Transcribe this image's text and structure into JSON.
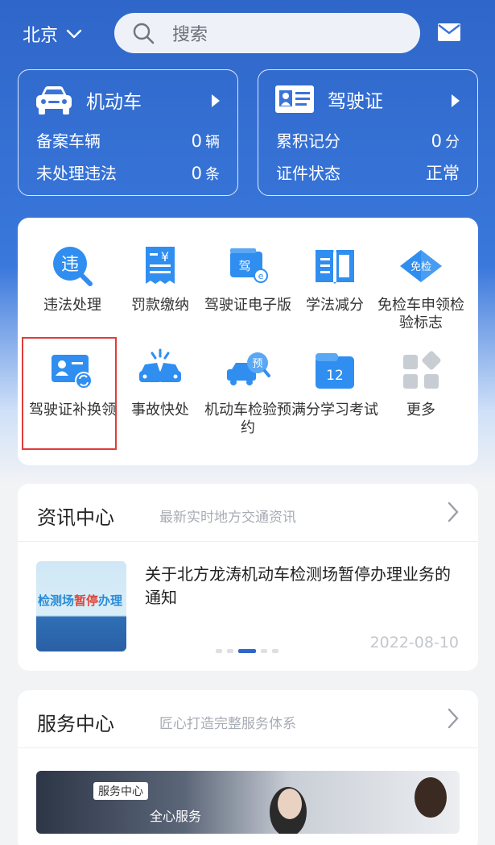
{
  "header": {
    "city": "北京",
    "search_placeholder": "搜索"
  },
  "cards": {
    "vehicle": {
      "title": "机动车",
      "rows": [
        {
          "label": "备案车辆",
          "value": "0",
          "unit": "辆"
        },
        {
          "label": "未处理违法",
          "value": "0",
          "unit": "条"
        }
      ]
    },
    "license": {
      "title": "驾驶证",
      "rows": [
        {
          "label": "累积记分",
          "value": "0",
          "unit": "分"
        },
        {
          "label": "证件状态",
          "value": "正常",
          "unit": ""
        }
      ]
    }
  },
  "services": [
    {
      "label": "违法处理",
      "icon": "violation-icon",
      "badge": "违"
    },
    {
      "label": "罚款缴纳",
      "icon": "fine-receipt-icon",
      "badge": "¥"
    },
    {
      "label": "驾驶证电子版",
      "icon": "e-license-icon",
      "badge": "驾"
    },
    {
      "label": "学法减分",
      "icon": "book-icon",
      "badge": ""
    },
    {
      "label": "免检车申领检验标志",
      "icon": "exempt-tag-icon",
      "badge": "免检"
    },
    {
      "label": "驾驶证补换领",
      "icon": "license-renew-icon",
      "badge": ""
    },
    {
      "label": "事故快处",
      "icon": "accident-icon",
      "badge": ""
    },
    {
      "label": "机动车检验预约",
      "icon": "inspection-booking-icon",
      "badge": "预"
    },
    {
      "label": "满分学习考试",
      "icon": "calendar-exam-icon",
      "badge": "12"
    },
    {
      "label": "更多",
      "icon": "more-grid-icon",
      "badge": ""
    }
  ],
  "news": {
    "title": "资讯中心",
    "subtitle": "最新实时地方交通资讯",
    "item_title": "关于北方龙涛机动车检测场暂停办理业务的通知",
    "item_date": "2022-08-10",
    "thumb_text_a": "检测场",
    "thumb_text_b": "暂停",
    "thumb_text_c": "办理",
    "carousel_total": 5,
    "carousel_active": 3
  },
  "service_center": {
    "title": "服务中心",
    "subtitle": "匠心打造完整服务体系",
    "banner_tag": "服务中心",
    "banner_slogan": "全心服务"
  },
  "colors": {
    "brand_blue": "#2f66c9",
    "highlight_red": "#e23b3b"
  }
}
